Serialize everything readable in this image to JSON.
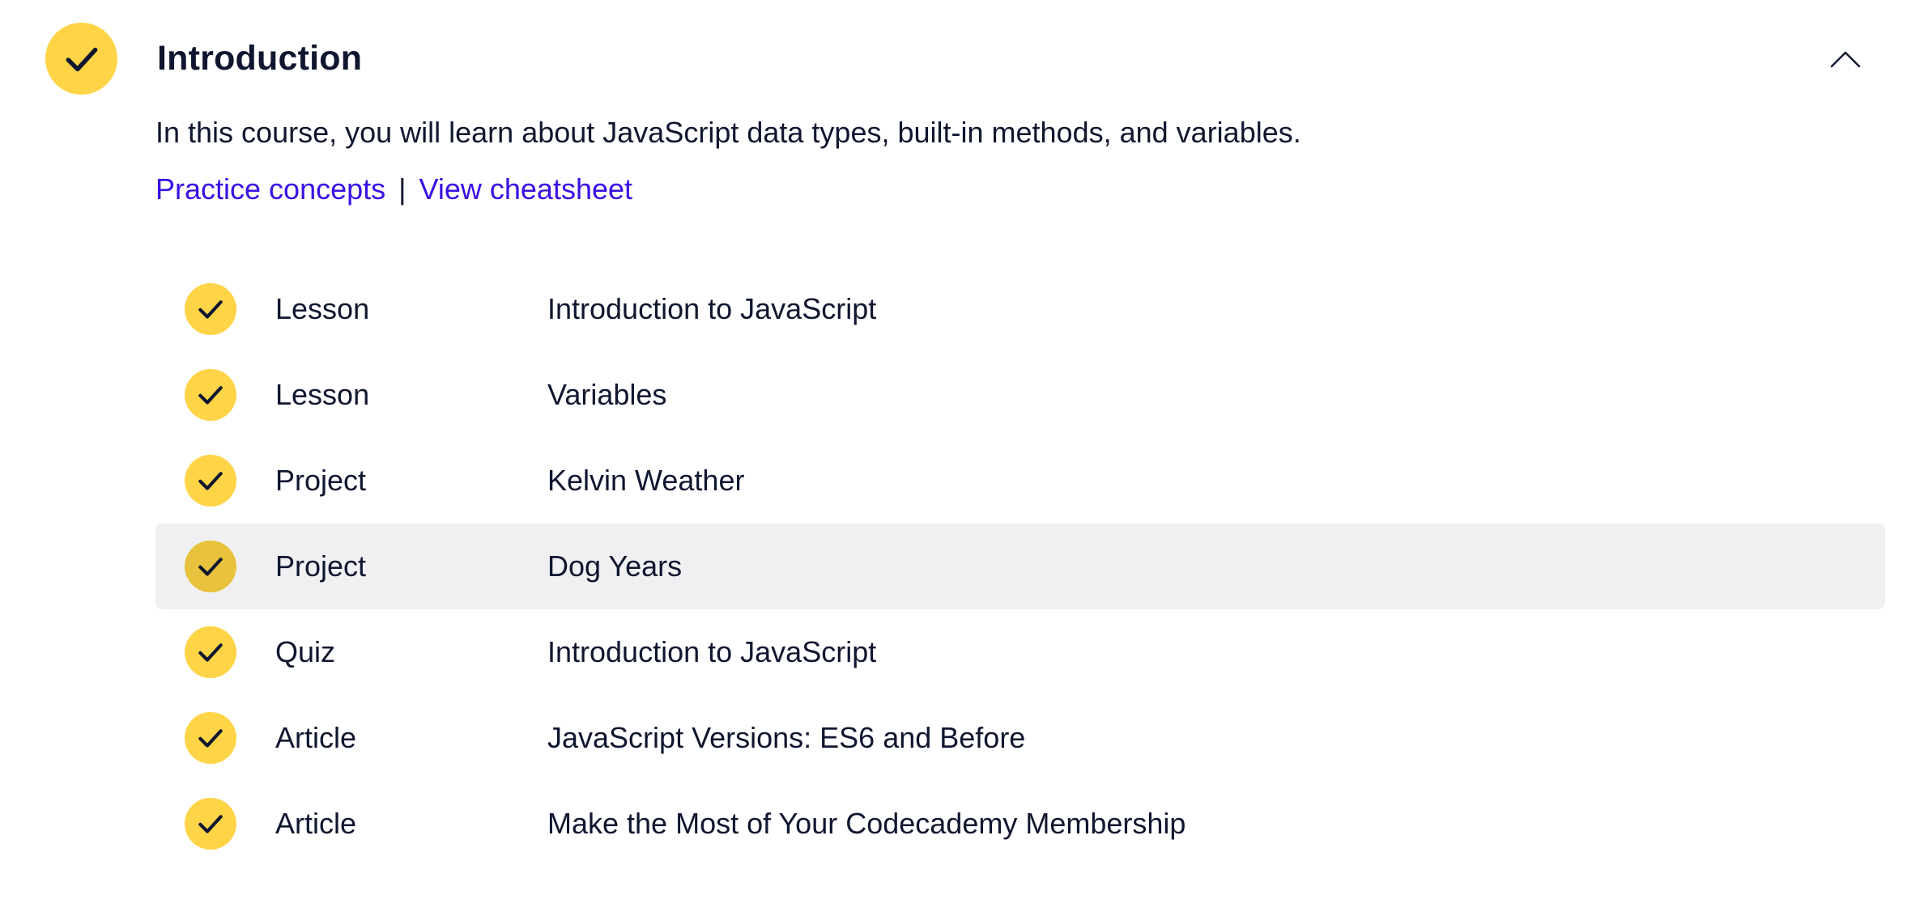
{
  "module": {
    "title": "Introduction",
    "completed": true,
    "expanded": true,
    "description": "In this course, you will learn about JavaScript data types, built-in methods, and variables.",
    "links": {
      "practice_label": "Practice concepts",
      "separator": "|",
      "cheatsheet_label": "View cheatsheet"
    }
  },
  "items": [
    {
      "type": "Lesson",
      "title": "Introduction to JavaScript",
      "completed": true,
      "hovered": false
    },
    {
      "type": "Lesson",
      "title": "Variables",
      "completed": true,
      "hovered": false
    },
    {
      "type": "Project",
      "title": "Kelvin Weather",
      "completed": true,
      "hovered": false
    },
    {
      "type": "Project",
      "title": "Dog Years",
      "completed": true,
      "hovered": true
    },
    {
      "type": "Quiz",
      "title": "Introduction to JavaScript",
      "completed": true,
      "hovered": false
    },
    {
      "type": "Article",
      "title": "JavaScript Versions: ES6 and Before",
      "completed": true,
      "hovered": false
    },
    {
      "type": "Article",
      "title": "Make the Most of Your Codecademy Membership",
      "completed": true,
      "hovered": false
    }
  ],
  "icons": {
    "module_status": "checkmark-icon",
    "item_status": "checkmark-icon",
    "collapse": "chevron-up-icon"
  },
  "colors": {
    "check_fill": "#ffd447",
    "check_fill_hover": "#e8c23c",
    "text": "#10162f",
    "link": "#3a10e5",
    "row_hover_bg": "#f0f0f2"
  }
}
